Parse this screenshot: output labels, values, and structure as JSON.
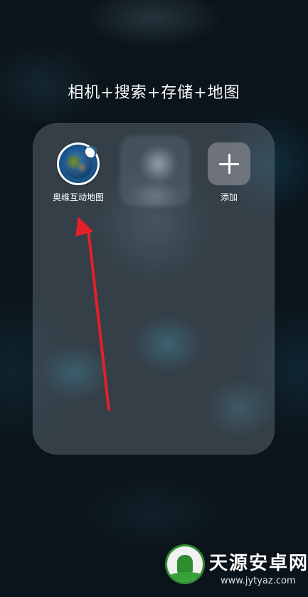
{
  "folder": {
    "title": "相机+搜索+存储+地图"
  },
  "apps": [
    {
      "label": "奥维互动地图",
      "icon": "aowei-map-icon"
    },
    {
      "label": "",
      "icon": "blurred-app-icon"
    },
    {
      "label": "添加",
      "icon": "plus-icon"
    }
  ],
  "annotation": {
    "arrow_color": "#e5202a",
    "icon": "red-arrow"
  },
  "watermark": {
    "text": "天源安卓网",
    "url": "www.jytyaz.com",
    "logo_color": "#2e8b2e"
  }
}
